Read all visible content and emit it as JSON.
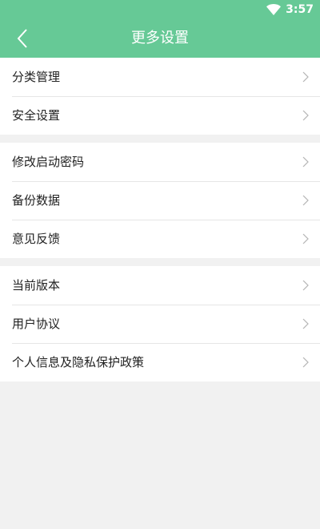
{
  "status_bar": {
    "time": "3:57",
    "icons": [
      "wifi-icon"
    ]
  },
  "header": {
    "title": "更多设置",
    "back_icon": "chevron-left-icon",
    "background_color": "#66c996",
    "text_color": "#ffffff"
  },
  "sections": [
    {
      "items": [
        {
          "label": "分类管理",
          "icon": "chevron-right-icon"
        },
        {
          "label": "安全设置",
          "icon": "chevron-right-icon"
        }
      ]
    },
    {
      "items": [
        {
          "label": "修改启动密码",
          "icon": "chevron-right-icon"
        },
        {
          "label": "备份数据",
          "icon": "chevron-right-icon"
        },
        {
          "label": "意见反馈",
          "icon": "chevron-right-icon"
        }
      ]
    },
    {
      "items": [
        {
          "label": "当前版本",
          "icon": "chevron-right-icon"
        },
        {
          "label": "用户协议",
          "icon": "chevron-right-icon"
        },
        {
          "label": "个人信息及隐私保护政策",
          "icon": "chevron-right-icon"
        }
      ]
    }
  ],
  "colors": {
    "page_background": "#f1f1f1",
    "row_background": "#ffffff",
    "divider": "#e6e6e6",
    "chevron": "#b5b5b5"
  }
}
